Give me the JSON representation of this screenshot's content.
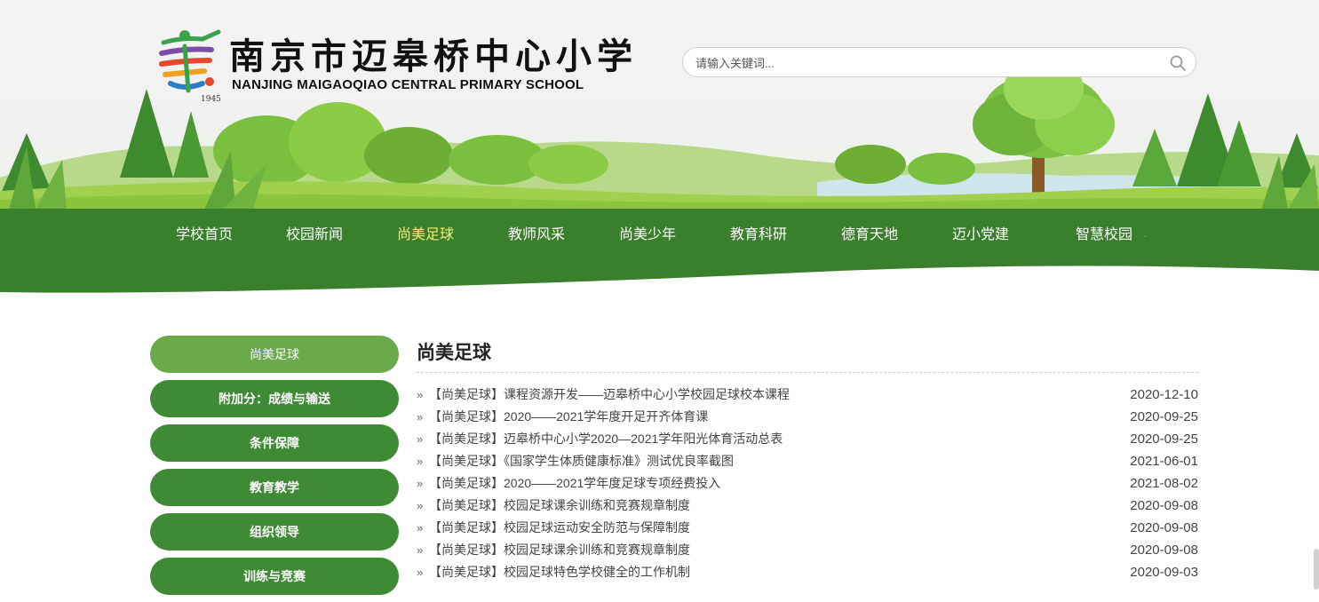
{
  "header": {
    "school_name_cn": "南京市迈皋桥中心小学",
    "school_name_en": "NANJING MAIGAOQIAO CENTRAL PRIMARY SCHOOL",
    "logo_year": "1945"
  },
  "search": {
    "placeholder": "请输入关键词...",
    "icon": "search-icon"
  },
  "nav": {
    "items": [
      {
        "label": "学校首页"
      },
      {
        "label": "校园新闻"
      },
      {
        "label": "尚美足球",
        "active": true
      },
      {
        "label": "教师风采"
      },
      {
        "label": "尚美少年"
      },
      {
        "label": "教育科研"
      },
      {
        "label": "德育天地"
      },
      {
        "label": "迈小党建"
      },
      {
        "label": "智慧校园"
      }
    ],
    "dropdown_icon": "chevron-down-icon"
  },
  "sidebar": {
    "items": [
      {
        "label": "尚美足球",
        "active": true
      },
      {
        "label": "附加分：成绩与输送"
      },
      {
        "label": "条件保障"
      },
      {
        "label": "教育教学"
      },
      {
        "label": "组织领导"
      },
      {
        "label": "训练与竞赛"
      }
    ]
  },
  "content": {
    "heading": "尚美足球",
    "articles": [
      {
        "title": "【尚美足球】课程资源开发——迈皋桥中心小学校园足球校本课程",
        "date": "2020-12-10"
      },
      {
        "title": "【尚美足球】2020——2021学年度开足开齐体育课",
        "date": "2020-09-25"
      },
      {
        "title": "【尚美足球】迈皋桥中心小学2020—2021学年阳光体育活动总表",
        "date": "2020-09-25"
      },
      {
        "title": "【尚美足球】《国家学生体质健康标准》测试优良率截图",
        "date": "2021-06-01"
      },
      {
        "title": "【尚美足球】2020——2021学年度足球专项经费投入",
        "date": "2021-08-02"
      },
      {
        "title": "【尚美足球】校园足球课余训练和竞赛规章制度",
        "date": "2020-09-08"
      },
      {
        "title": "【尚美足球】校园足球运动安全防范与保障制度",
        "date": "2020-09-08"
      },
      {
        "title": "【尚美足球】校园足球课余训练和竞赛规章制度",
        "date": "2020-09-08"
      },
      {
        "title": "【尚美足球】校园足球特色学校健全的工作机制",
        "date": "2020-09-03"
      }
    ]
  },
  "colors": {
    "nav_green": "#3a7f2c",
    "active_nav_text": "#f2ec76",
    "sidebar_green": "#3f8a35",
    "sidebar_active": "#6aaa4b"
  }
}
